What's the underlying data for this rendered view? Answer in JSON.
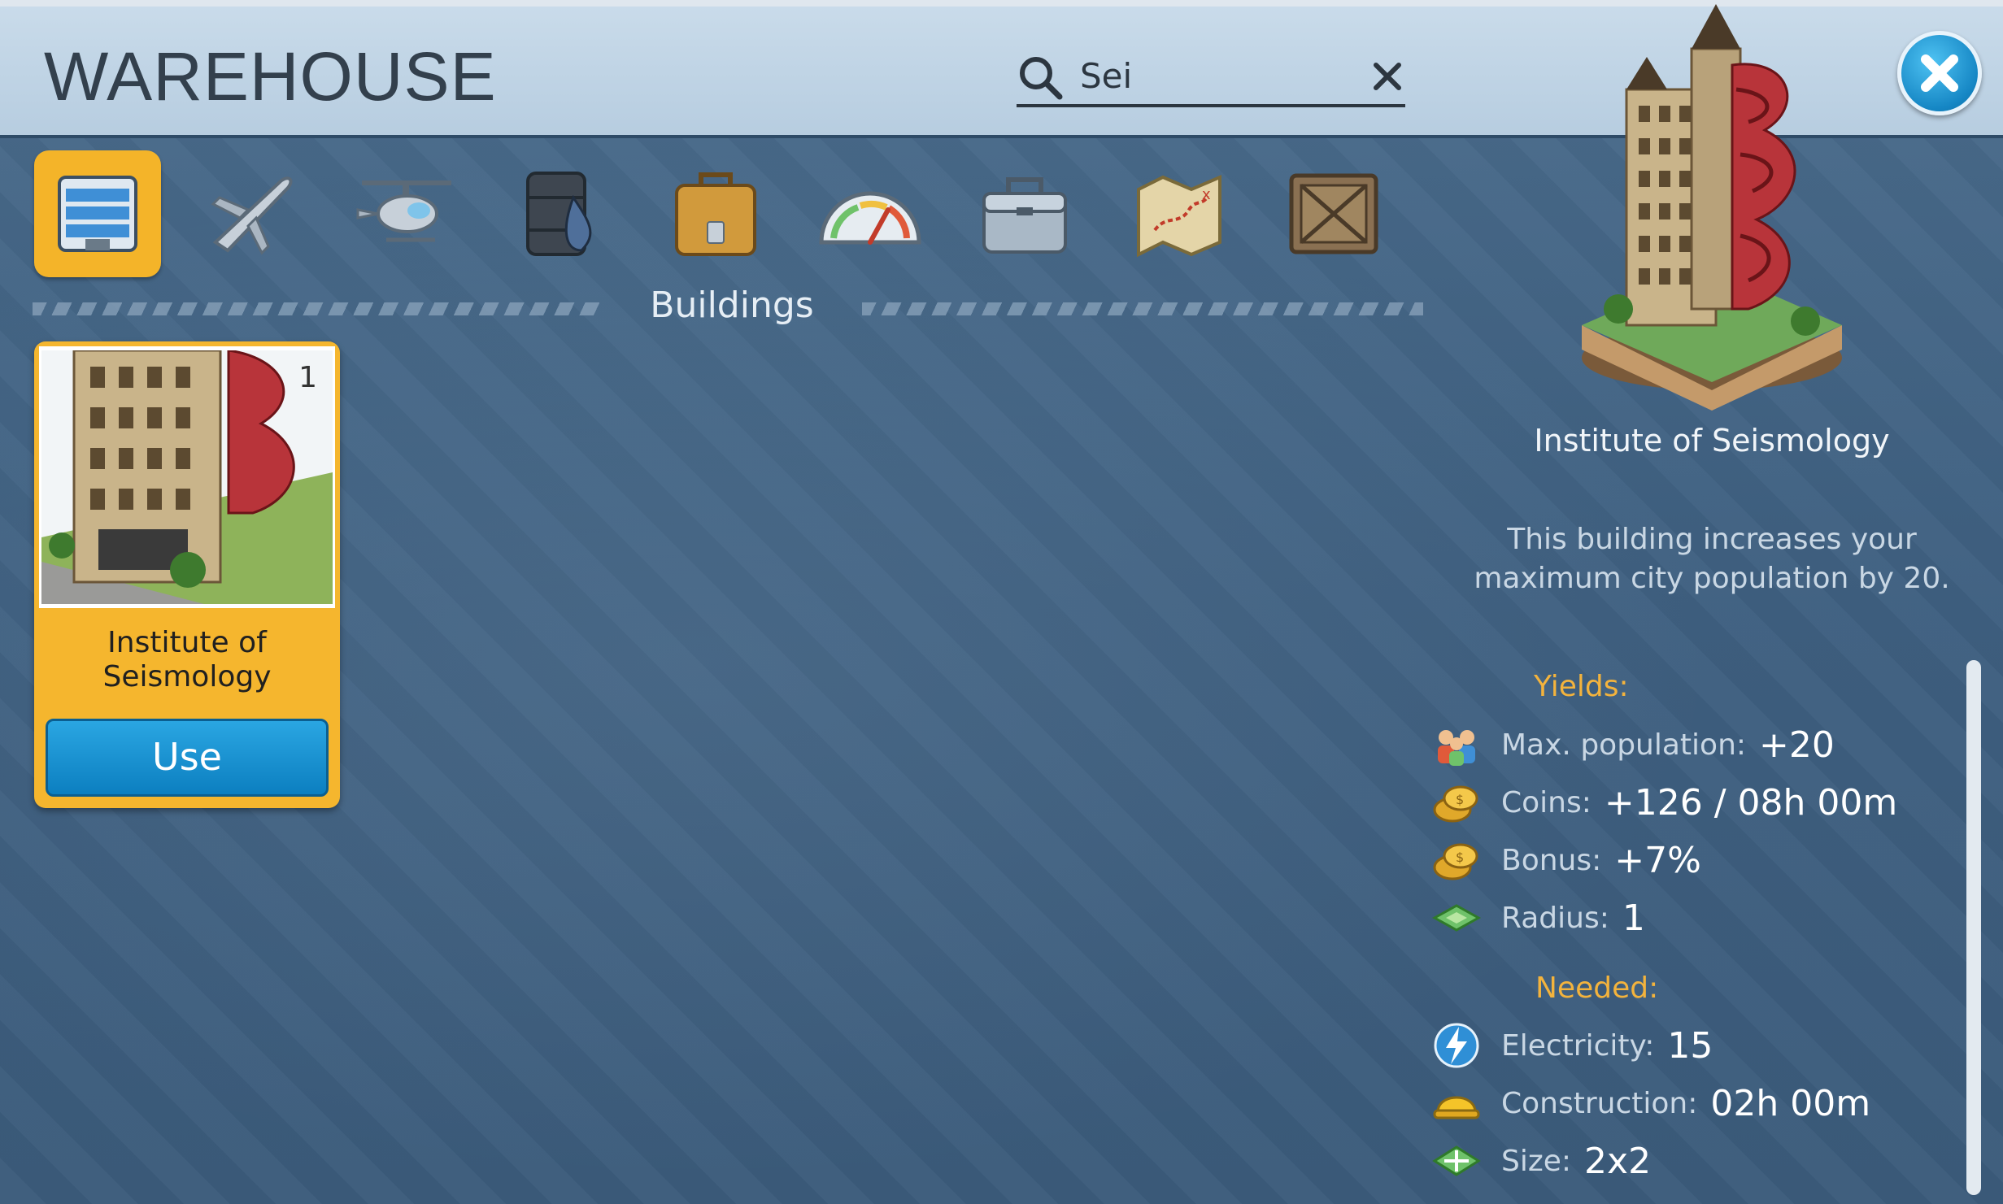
{
  "window": {
    "title": "WAREHOUSE"
  },
  "search": {
    "value": "Sei",
    "placeholder": ""
  },
  "tabs": [
    {
      "name": "buildings",
      "icon": "building-icon",
      "active": true
    },
    {
      "name": "airplanes",
      "icon": "airplane-icon",
      "active": false
    },
    {
      "name": "helicopters",
      "icon": "helicopter-icon",
      "active": false
    },
    {
      "name": "resources",
      "icon": "oil-barrel-icon",
      "active": false
    },
    {
      "name": "items",
      "icon": "suitcase-icon",
      "active": false
    },
    {
      "name": "boosts",
      "icon": "speedometer-icon",
      "active": false
    },
    {
      "name": "tools",
      "icon": "toolbox-icon",
      "active": false
    },
    {
      "name": "maps",
      "icon": "map-icon",
      "active": false
    },
    {
      "name": "crates",
      "icon": "crate-icon",
      "active": false
    }
  ],
  "section": {
    "title": "Buildings"
  },
  "items": [
    {
      "name": "Institute of Seismology",
      "count": "1",
      "use_label": "Use"
    }
  ],
  "detail": {
    "name": "Institute of Seismology",
    "description": "This building increases your maximum city population by 20.",
    "yields_label": "Yields:",
    "yields": [
      {
        "icon": "population-icon",
        "label": "Max. population:",
        "value": "+20"
      },
      {
        "icon": "coins-icon",
        "label": "Coins:",
        "value": "+126 / 08h 00m"
      },
      {
        "icon": "coins-icon",
        "label": "Bonus:",
        "value": "+7%"
      },
      {
        "icon": "radius-icon",
        "label": "Radius:",
        "value": "1"
      }
    ],
    "needed_label": "Needed:",
    "needed": [
      {
        "icon": "electricity-icon",
        "label": "Electricity:",
        "value": "15"
      },
      {
        "icon": "hardhat-icon",
        "label": "Construction:",
        "value": "02h 00m"
      },
      {
        "icon": "size-icon",
        "label": "Size:",
        "value": "2x2"
      }
    ]
  },
  "colors": {
    "accent": "#f4b429",
    "button_blue": "#1586c4",
    "label_orange": "#f3b33d"
  }
}
